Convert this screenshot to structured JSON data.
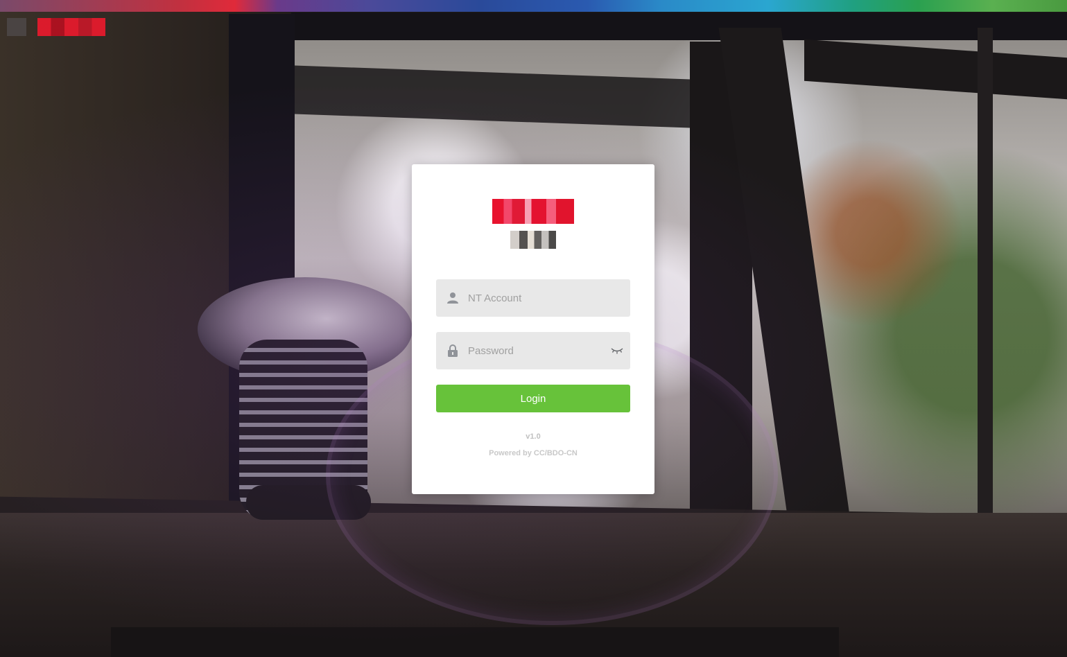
{
  "login_form": {
    "username_placeholder": "NT Account",
    "username_value": "",
    "password_placeholder": "Password",
    "password_value": "",
    "login_label": "Login"
  },
  "footer": {
    "version": "v1.0",
    "powered_by": "Powered by CC/BDO-CN"
  },
  "icons": {
    "username": "user-icon",
    "password": "lock-icon",
    "toggle_password": "eye-closed-icon"
  },
  "colors": {
    "login_button": "#67c23a",
    "input_background": "#e8e8e8",
    "card_background": "#ffffff",
    "brand": "#e41a2c"
  }
}
